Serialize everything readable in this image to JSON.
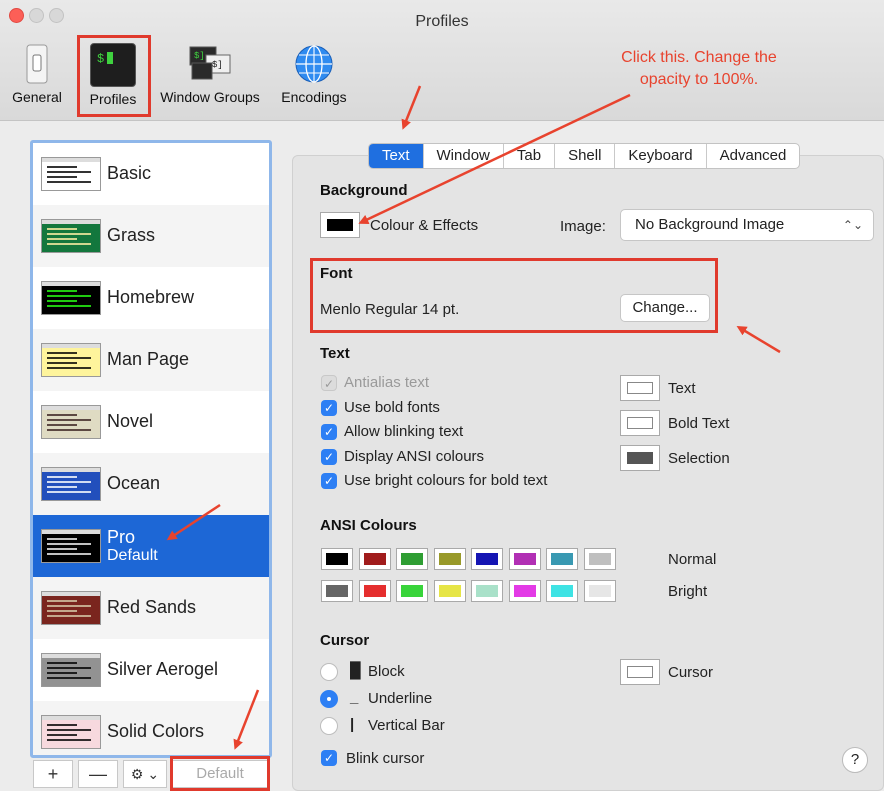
{
  "window": {
    "title": "Profiles"
  },
  "toolbar": {
    "items": [
      {
        "label": "General",
        "icon": "switch-icon"
      },
      {
        "label": "Profiles",
        "icon": "terminal-icon"
      },
      {
        "label": "Window Groups",
        "icon": "window-groups-icon"
      },
      {
        "label": "Encodings",
        "icon": "globe-icon"
      }
    ]
  },
  "annotation": {
    "text": "Click this. Change the opacity to 100%.",
    "line1": "Click this. Change the",
    "line2": "opacity to 100%.",
    "color": "#e8432e"
  },
  "profiles": [
    {
      "name": "Basic",
      "subtitle": "",
      "bg": "#ffffff",
      "fg": "#000000"
    },
    {
      "name": "Grass",
      "subtitle": "",
      "bg": "#13773d",
      "fg": "#fff0a5"
    },
    {
      "name": "Homebrew",
      "subtitle": "",
      "bg": "#000000",
      "fg": "#28fe14"
    },
    {
      "name": "Man Page",
      "subtitle": "",
      "bg": "#fef49c",
      "fg": "#000000"
    },
    {
      "name": "Novel",
      "subtitle": "",
      "bg": "#dfdbc3",
      "fg": "#3b2322"
    },
    {
      "name": "Ocean",
      "subtitle": "",
      "bg": "#224fbc",
      "fg": "#ffffff"
    },
    {
      "name": "Pro",
      "subtitle": "Default",
      "bg": "#000000",
      "fg": "#f2f2f2"
    },
    {
      "name": "Red Sands",
      "subtitle": "",
      "bg": "#7a251e",
      "fg": "#d7c9a7"
    },
    {
      "name": "Silver Aerogel",
      "subtitle": "",
      "bg": "#929292",
      "fg": "#000000"
    },
    {
      "name": "Solid Colors",
      "subtitle": "",
      "bg": "#f7d9de",
      "fg": "#000000"
    }
  ],
  "sidebar_buttons": {
    "add": "+",
    "remove": "—",
    "gear": "⚙ ⌄",
    "default": "Default"
  },
  "tabs": [
    "Text",
    "Window",
    "Tab",
    "Shell",
    "Keyboard",
    "Advanced"
  ],
  "background": {
    "heading": "Background",
    "colour_label": "Colour & Effects",
    "colour_value": "#000000",
    "image_label": "Image:",
    "image_value": "No Background Image"
  },
  "font": {
    "heading": "Font",
    "value": "Menlo Regular 14 pt.",
    "change": "Change..."
  },
  "text": {
    "heading": "Text",
    "options": [
      {
        "label": "Antialias text",
        "checked": true,
        "disabled": true
      },
      {
        "label": "Use bold fonts",
        "checked": true,
        "disabled": false
      },
      {
        "label": "Allow blinking text",
        "checked": true,
        "disabled": false
      },
      {
        "label": "Display ANSI colours",
        "checked": true,
        "disabled": false
      },
      {
        "label": "Use bright colours for bold text",
        "checked": true,
        "disabled": false
      }
    ],
    "colours": [
      {
        "label": "Text",
        "color": "#ffffff"
      },
      {
        "label": "Bold Text",
        "color": "#ffffff"
      },
      {
        "label": "Selection",
        "color": "#555555"
      }
    ]
  },
  "ansi": {
    "heading": "ANSI Colours",
    "normal_label": "Normal",
    "bright_label": "Bright",
    "normal": [
      "#000000",
      "#a11c1c",
      "#2f9e33",
      "#999a2a",
      "#1515b3",
      "#b12fb4",
      "#3999b2",
      "#bfbfbf"
    ],
    "bright": [
      "#666666",
      "#e52e2e",
      "#38d43a",
      "#e6e546",
      "#a9e1c9",
      "#e33ae6",
      "#3ee3e4",
      "#e6e6e6"
    ]
  },
  "cursor": {
    "heading": "Cursor",
    "styles": [
      {
        "glyph": "█",
        "label": "Block",
        "selected": false
      },
      {
        "glyph": "_",
        "label": "Underline",
        "selected": true
      },
      {
        "glyph": "|",
        "label": "Vertical Bar",
        "selected": false
      }
    ],
    "blink_label": "Blink cursor",
    "blink_checked": true,
    "colour_label": "Cursor",
    "colour_value": "#ffffff"
  },
  "help": "?"
}
